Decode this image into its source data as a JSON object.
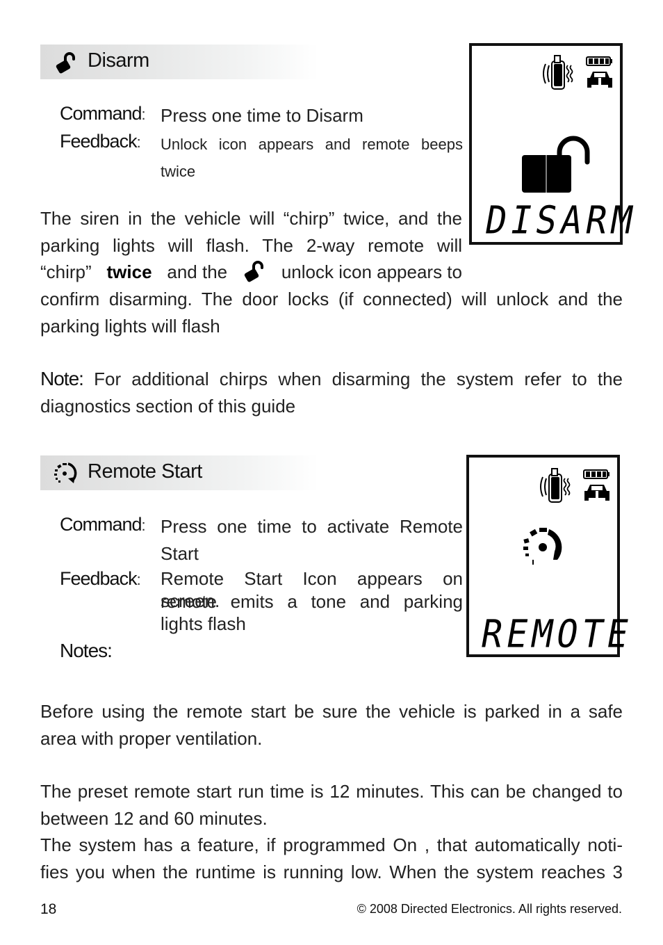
{
  "disarm": {
    "title": "Disarm",
    "icon": "unlock-icon",
    "command_label": "Command",
    "command_text": "Press one time to Disarm",
    "feedback_label": "Feedback",
    "feedback_text": "Unlock icon appears and remote beeps twice",
    "feedback_line1": "Unlock icon appears and remote beeps",
    "feedback_line2": "twice",
    "paragraph": {
      "line1": "The siren in the vehicle will “chirp” twice, and the",
      "line2": "parking lights will flash. The 2-way remote will",
      "line3_pre": "“chirp”",
      "line3_bold": "twice",
      "line3_mid": "and the",
      "line3_post": "unlock icon appears to",
      "line4": "confirm disarming. The door locks (if connected) will unlock and the",
      "line5": "parking lights will flash"
    },
    "note_label": "Note:",
    "note_text_line1": "For additional chirps when disarming the system refer to the",
    "note_text_line2": "diagnostics section of this guide",
    "lcd": {
      "word": "DISARM",
      "icons": [
        "remote-transmit-icon",
        "battery-full-icon",
        "car-icon",
        "unlock-icon"
      ],
      "battery_level": "4/4"
    }
  },
  "remote_start": {
    "title": "Remote Start",
    "icon": "remote-start-icon",
    "command_label": "Command",
    "command_line1": "Press one time to activate Remote",
    "command_line2": "Start",
    "feedback_label": "Feedback",
    "feedback_line1": "Remote Start Icon appears on screen.",
    "feedback_line2": "remote emits a tone and parking",
    "feedback_line3": "lights flash",
    "notes_label": "Notes:",
    "para1_line1": "Before using the remote start be sure the vehicle is parked in a safe",
    "para1_line2": "area with proper ventilation.",
    "para2_line1": "The preset remote start run time is 12 minutes. This can be changed to",
    "para2_line2": "between 12 and 60 minutes.",
    "para3_line1": "The system has a feature, if programmed On , that automatically noti-",
    "para3_line2": "fies you when the runtime is running low. When the system reaches 3",
    "lcd": {
      "word": "REMOTE",
      "icons": [
        "remote-transmit-icon",
        "battery-full-icon",
        "car-icon",
        "remote-start-icon"
      ],
      "battery_level": "4/4"
    }
  },
  "colon": ":",
  "footer": {
    "page_number": "18",
    "copyright": "© 2008 Directed Electronics. All rights reserved."
  }
}
